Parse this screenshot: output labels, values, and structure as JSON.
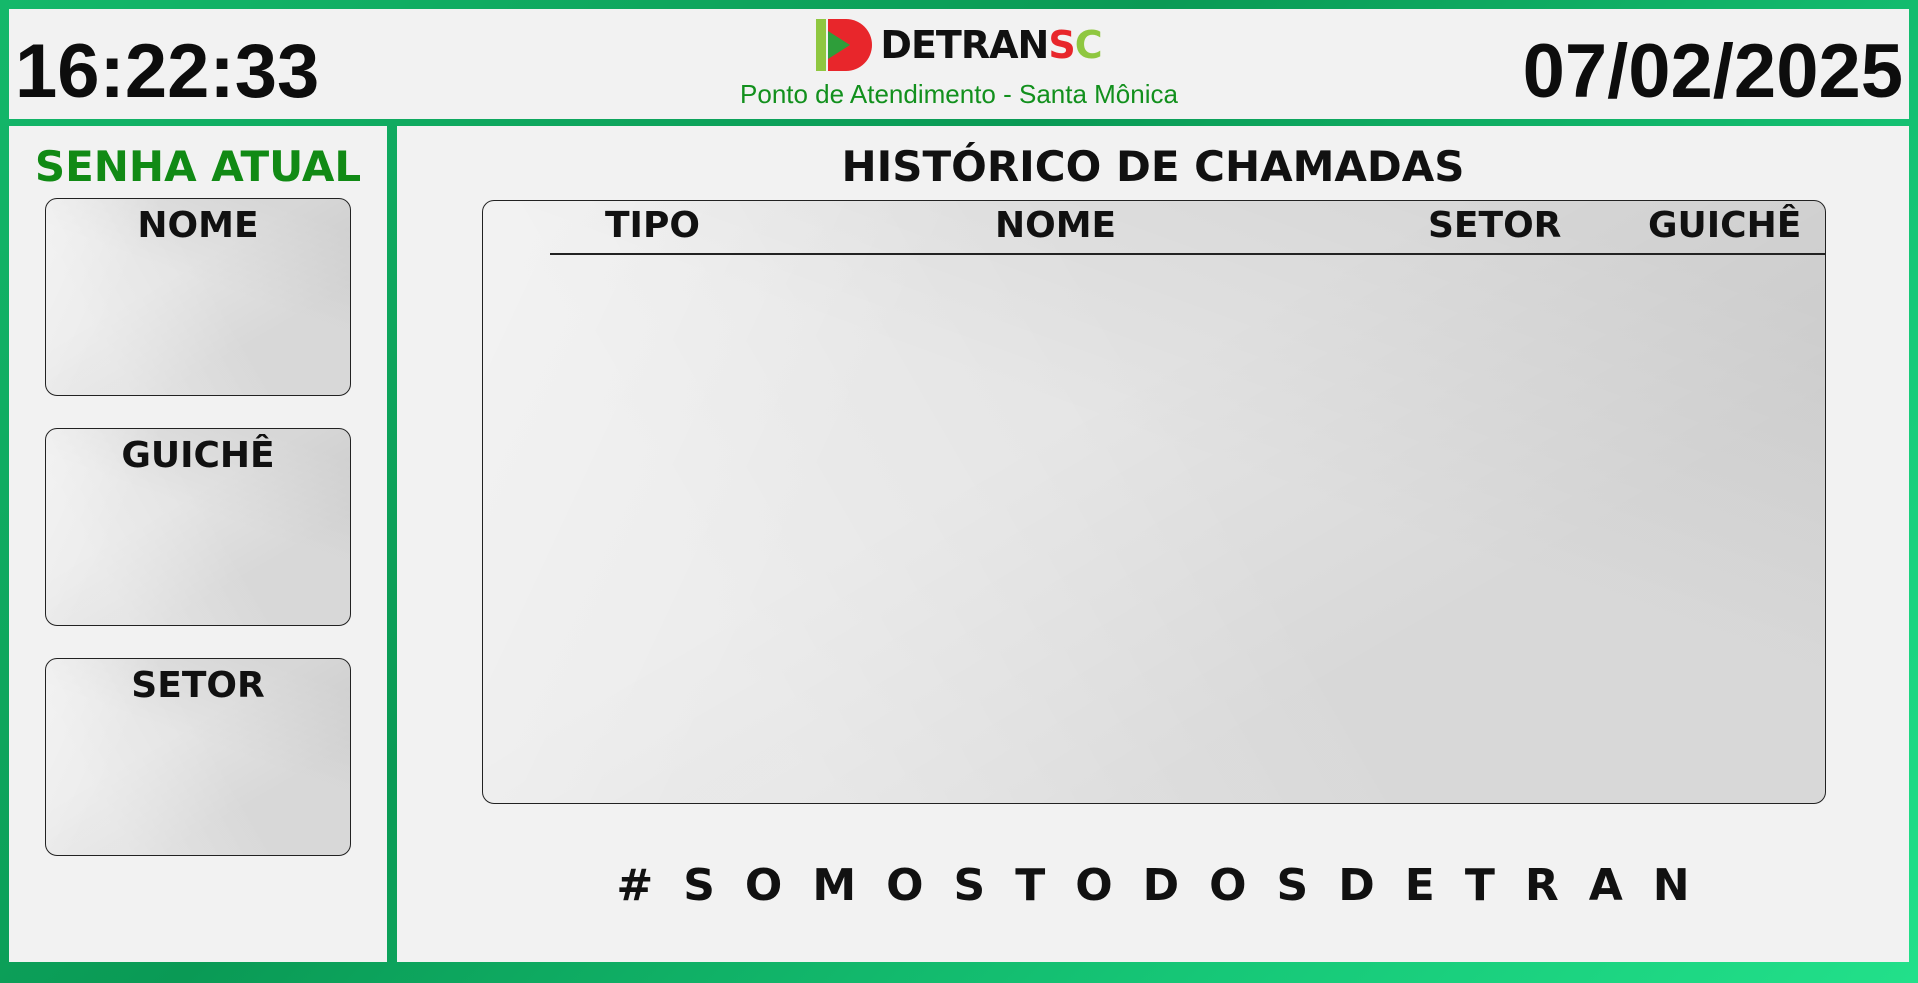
{
  "header": {
    "time": "16:22:33",
    "date": "07/02/2025",
    "logo": {
      "text_a": "DETRAN",
      "text_s": "S",
      "text_c": "C"
    },
    "subtitle": "Ponto de Atendimento - Santa Mônica"
  },
  "current_ticket": {
    "title": "SENHA ATUAL",
    "cards": [
      {
        "label": "NOME",
        "value": ""
      },
      {
        "label": "GUICHÊ",
        "value": ""
      },
      {
        "label": "SETOR",
        "value": ""
      }
    ]
  },
  "history": {
    "title": "HISTÓRICO DE CHAMADAS",
    "columns": [
      "TIPO",
      "NOME",
      "SETOR",
      "GUICHÊ"
    ],
    "rows": []
  },
  "slogan": "#SOMOSTODOSDETRAN",
  "colors": {
    "brand_green": "#118a15",
    "subtitle_green": "#12901d",
    "logo_red": "#e8262b",
    "logo_lime": "#8fc740",
    "frame_green": "#14b86a"
  }
}
